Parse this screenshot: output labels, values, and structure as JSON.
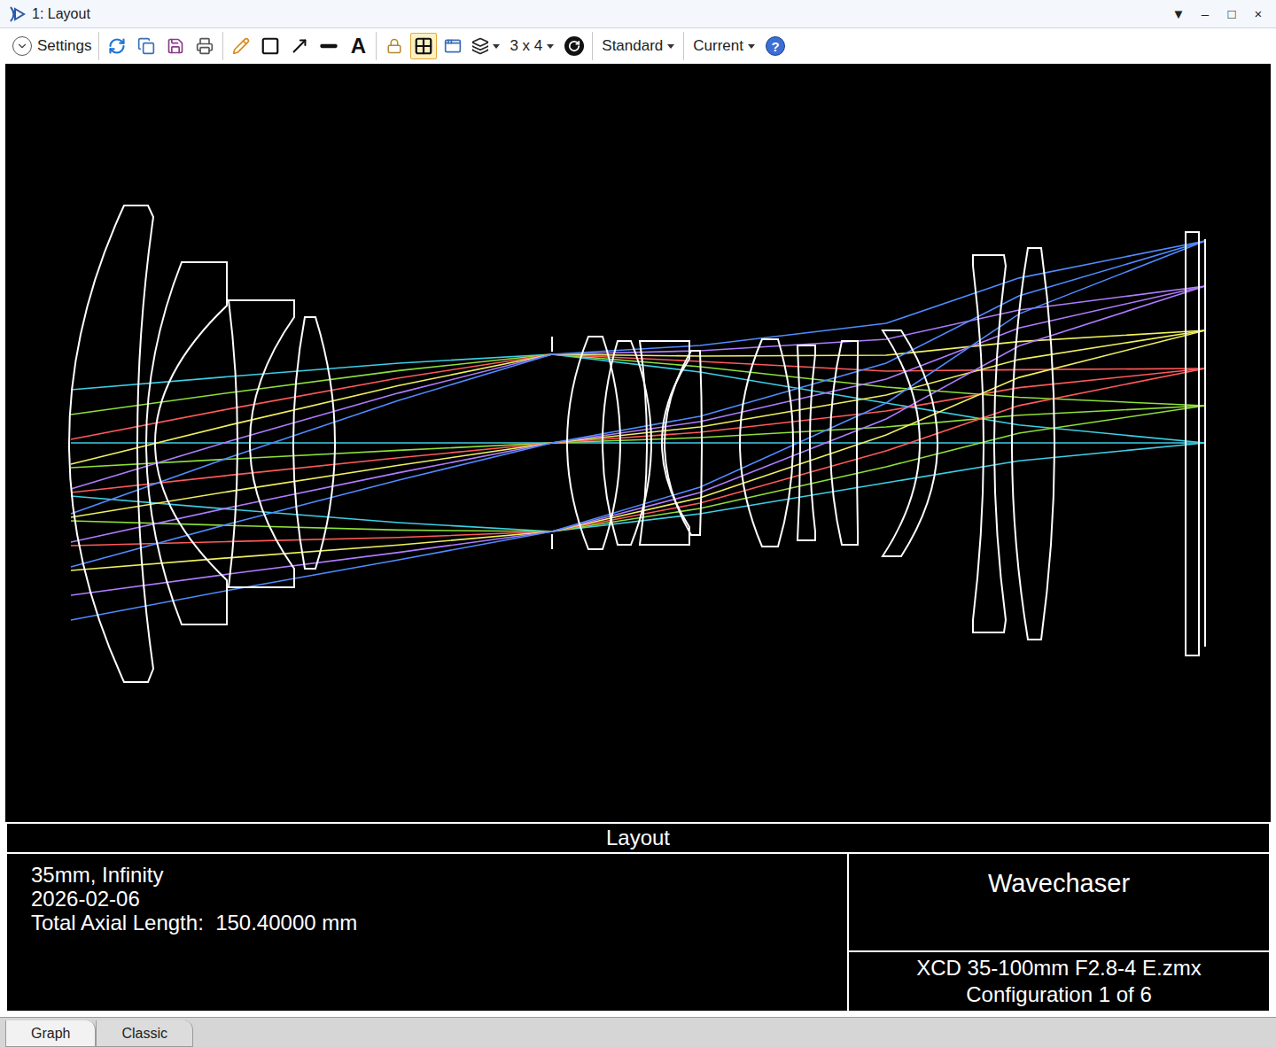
{
  "window": {
    "title": "1: Layout",
    "controls": [
      "▼",
      "–",
      "□",
      "×"
    ]
  },
  "toolbar": {
    "groups": [
      [
        {
          "kind": "settings",
          "label": "Settings",
          "selected": false
        }
      ],
      [
        {
          "kind": "refresh",
          "selected": false
        },
        {
          "kind": "copy",
          "selected": false
        },
        {
          "kind": "save",
          "selected": false
        },
        {
          "kind": "print",
          "selected": false
        }
      ],
      [
        {
          "kind": "pencil",
          "selected": false
        },
        {
          "kind": "rectangle",
          "selected": false
        },
        {
          "kind": "arrow",
          "selected": false
        },
        {
          "kind": "line",
          "selected": false
        },
        {
          "kind": "text",
          "label": "A",
          "selected": false
        }
      ],
      [
        {
          "kind": "lock",
          "selected": false
        },
        {
          "kind": "fit",
          "selected": true
        },
        {
          "kind": "overlay",
          "selected": false
        },
        {
          "kind": "layers",
          "selected": false
        },
        {
          "kind": "dropdown",
          "label": "3 x 4",
          "selected": false
        },
        {
          "kind": "rotate",
          "selected": false
        }
      ],
      [
        {
          "kind": "dropdown",
          "label": "Standard",
          "selected": false
        }
      ],
      [
        {
          "kind": "dropdown",
          "label": "Current",
          "selected": false
        },
        {
          "kind": "help",
          "label": "?",
          "selected": false
        }
      ]
    ]
  },
  "layout": {
    "fields": [
      {
        "color": "#3ccfe6"
      },
      {
        "color": "#8ee03a"
      },
      {
        "color": "#ff5a5a"
      },
      {
        "color": "#f0f060"
      },
      {
        "color": "#b07cff"
      },
      {
        "color": "#4f8cff"
      }
    ]
  },
  "info": {
    "header": "Layout",
    "lines": [
      "35mm, Infinity",
      "2026-02-06",
      "Total Axial Length:  150.40000 mm"
    ],
    "company": "Wavechaser",
    "file": "XCD 35-100mm F2.8-4 E.zmx",
    "configuration": "Configuration 1 of 6"
  },
  "tabs": [
    {
      "label": "Graph",
      "selected": true
    },
    {
      "label": "Classic",
      "selected": false
    }
  ]
}
